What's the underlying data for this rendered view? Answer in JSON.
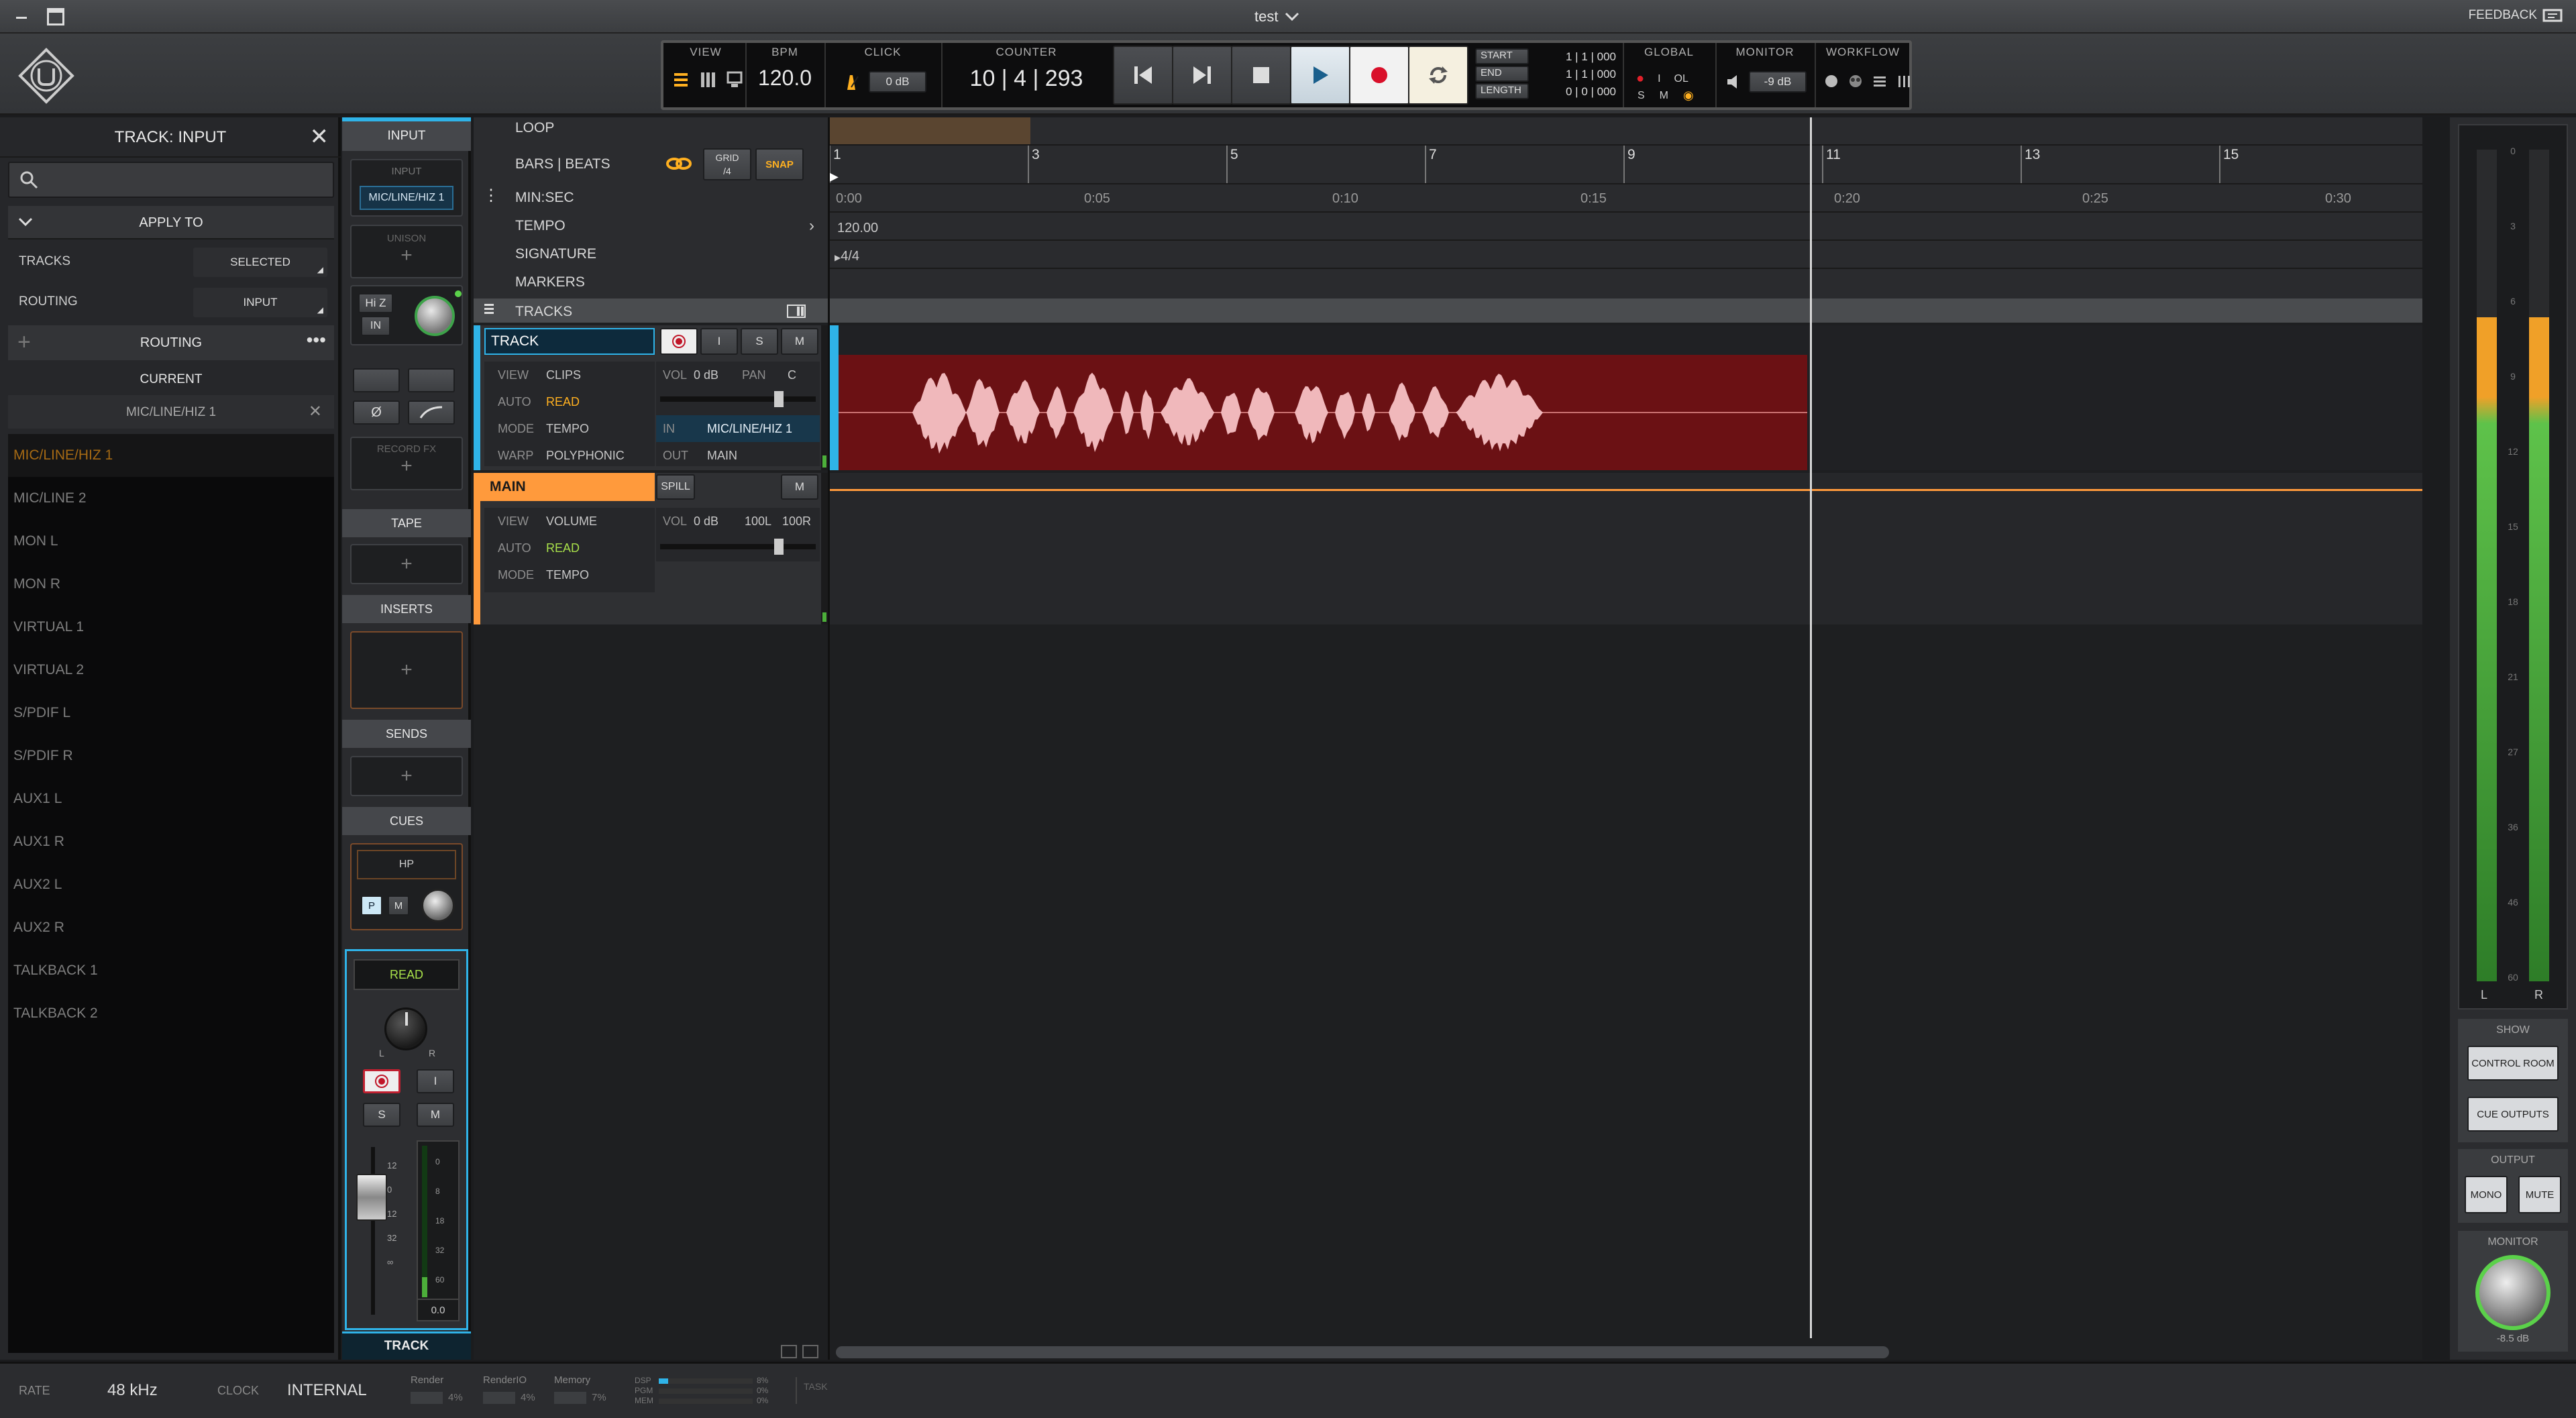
{
  "window": {
    "title": "test",
    "feedback_label": "FEEDBACK"
  },
  "toolbar": {
    "view_label": "VIEW",
    "bpm_label": "BPM",
    "bpm_value": "120.0",
    "click_label": "CLICK",
    "click_value": "0 dB",
    "counter_label": "COUNTER",
    "counter_value": "10 | 4 | 293",
    "start_label": "START",
    "end_label": "END",
    "length_label": "LENGTH",
    "start_value": "1 | 1 | 000",
    "end_value": "1 | 1 | 000",
    "length_value": "0 | 0 | 000",
    "global_label": "GLOBAL",
    "global_i": "I",
    "global_ol": "OL",
    "global_s": "S",
    "global_m": "M",
    "monitor_label": "MONITOR",
    "monitor_value": "-9 dB",
    "workflow_label": "WORKFLOW"
  },
  "inspector": {
    "title": "TRACK: INPUT",
    "apply_to": "APPLY TO",
    "tracks_label": "TRACKS",
    "tracks_value": "SELECTED",
    "routing_label": "ROUTING",
    "routing_value": "INPUT",
    "routing_header": "ROUTING",
    "current_label": "CURRENT",
    "current_value": "MIC/LINE/HIZ 1",
    "inputs": [
      "MIC/LINE/HIZ 1",
      "MIC/LINE 2",
      "MON L",
      "MON R",
      "VIRTUAL 1",
      "VIRTUAL 2",
      "S/PDIF L",
      "S/PDIF R",
      "AUX1 L",
      "AUX1 R",
      "AUX2 L",
      "AUX2 R",
      "TALKBACK 1",
      "TALKBACK 2"
    ]
  },
  "channel": {
    "input_header": "INPUT",
    "input_label": "INPUT",
    "input_value": "MIC/LINE/HIZ 1",
    "unison_label": "UNISON",
    "hiz_label": "Hi Z",
    "in_label": "IN",
    "phase_label": "Ø",
    "record_fx_label": "RECORD FX",
    "tape_label": "TAPE",
    "inserts_label": "INSERTS",
    "sends_label": "SENDS",
    "cues_label": "CUES",
    "hp_label": "HP",
    "p_label": "P",
    "m_label": "M",
    "automation": "READ",
    "pan_l": "L",
    "pan_r": "R",
    "rec_i": "I",
    "solo": "S",
    "mute": "M",
    "fader_scale": [
      "12",
      "0",
      "12",
      "32",
      "∞"
    ],
    "meter_scale": [
      "0",
      "8",
      "18",
      "32",
      "60"
    ],
    "fader_value": "0.0",
    "bottom_tab": "TRACK"
  },
  "timeline": {
    "loop_label": "LOOP",
    "bars_label": "BARS | BEATS",
    "grid_label": "GRID",
    "grid_value": "/4",
    "snap_label": "SNAP",
    "minsec_label": "MIN:SEC",
    "tempo_label": "TEMPO",
    "tempo_value": "120.00",
    "signature_label": "SIGNATURE",
    "signature_value": "4/4",
    "markers_label": "MARKERS",
    "tracks_label": "TRACKS",
    "bars": [
      "1",
      "3",
      "5",
      "7",
      "9",
      "11",
      "13",
      "15"
    ],
    "times": [
      "0:00",
      "0:05",
      "0:10",
      "0:15",
      "0:20",
      "0:25",
      "0:30"
    ]
  },
  "track": {
    "name": "TRACK",
    "i": "I",
    "s": "S",
    "m": "M",
    "view_label": "VIEW",
    "view_value": "CLIPS",
    "auto_label": "AUTO",
    "auto_value": "READ",
    "mode_label": "MODE",
    "mode_value": "TEMPO",
    "warp_label": "WARP",
    "warp_value": "POLYPHONIC",
    "vol_label": "VOL",
    "vol_value": "0 dB",
    "pan_label": "PAN",
    "pan_value": "C",
    "in_label": "IN",
    "in_value": "MIC/LINE/HIZ 1",
    "out_label": "OUT",
    "out_value": "MAIN"
  },
  "main": {
    "name": "MAIN",
    "spill": "SPILL",
    "m": "M",
    "view_label": "VIEW",
    "view_value": "VOLUME",
    "auto_label": "AUTO",
    "auto_value": "READ",
    "mode_label": "MODE",
    "mode_value": "TEMPO",
    "vol_label": "VOL",
    "vol_value": "0 dB",
    "pan_l": "100L",
    "pan_r": "100R"
  },
  "right": {
    "meter_scale": [
      "0",
      "3",
      "6",
      "9",
      "12",
      "15",
      "18",
      "21",
      "27",
      "36",
      "46",
      "60"
    ],
    "meter_l": "L",
    "meter_r": "R",
    "show_label": "SHOW",
    "control_room": "CONTROL ROOM",
    "cue_outputs": "CUE OUTPUTS",
    "output_label": "OUTPUT",
    "mono": "MONO",
    "mute": "MUTE",
    "monitor_label": "MONITOR",
    "monitor_value": "-8.5 dB"
  },
  "status": {
    "rate_label": "RATE",
    "rate_value": "48 kHz",
    "clock_label": "CLOCK",
    "clock_value": "INTERNAL",
    "render_label": "Render",
    "render_value": "4%",
    "renderio_label": "RenderIO",
    "renderio_value": "4%",
    "memory_label": "Memory",
    "memory_value": "7%",
    "dsp_label": "DSP",
    "pgm_label": "PGM",
    "mem_label": "MEM",
    "dsp_value": "8%",
    "pgm_value": "0%",
    "mem_value": "0%",
    "task_label": "TASK"
  },
  "colors": {
    "accent_blue": "#2fb3e8",
    "main_orange": "#ff9a3c",
    "read_green": "#a8e04a",
    "clip_red": "#6b1114",
    "wave": "#f0b8bb"
  }
}
